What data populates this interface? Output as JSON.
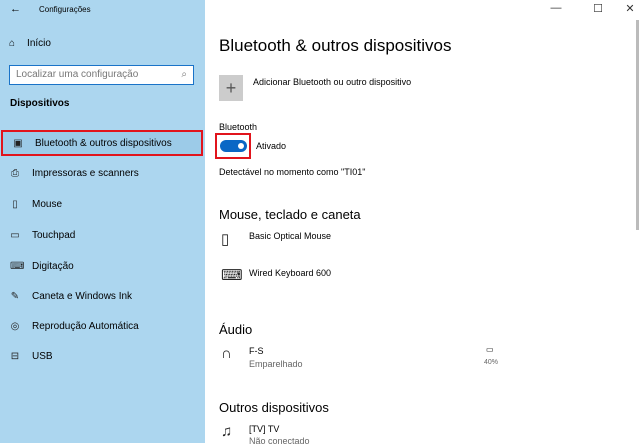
{
  "window": {
    "title": "Configurações",
    "back": "←",
    "minimize": "—",
    "maximize": "☐",
    "close": "✕"
  },
  "sidebar": {
    "home": "Início",
    "search_placeholder": "Localizar uma configuração",
    "section": "Dispositivos",
    "items": [
      {
        "label": "Bluetooth & outros dispositivos",
        "icon": "▣"
      },
      {
        "label": "Impressoras e scanners",
        "icon": "⎙"
      },
      {
        "label": "Mouse",
        "icon": "▯"
      },
      {
        "label": "Touchpad",
        "icon": "▭"
      },
      {
        "label": "Digitação",
        "icon": "⌨"
      },
      {
        "label": "Caneta e Windows Ink",
        "icon": "✎"
      },
      {
        "label": "Reprodução Automática",
        "icon": "◎"
      },
      {
        "label": "USB",
        "icon": "⊟"
      }
    ]
  },
  "main": {
    "title": "Bluetooth & outros dispositivos",
    "add_label": "Adicionar Bluetooth ou outro dispositivo",
    "bt_label": "Bluetooth",
    "bt_state": "Ativado",
    "bt_on": true,
    "discoverable": "Detectável no momento como \"TI01\"",
    "mouse_section": "Mouse, teclado e caneta",
    "mouse": "Basic Optical Mouse",
    "keyboard": "Wired Keyboard 600",
    "audio_section": "Áudio",
    "audio_name": "F-S",
    "audio_status": "Emparelhado",
    "audio_battery": "40%",
    "other_section": "Outros dispositivos",
    "other_name": "[TV] TV",
    "other_status": "Não conectado"
  }
}
